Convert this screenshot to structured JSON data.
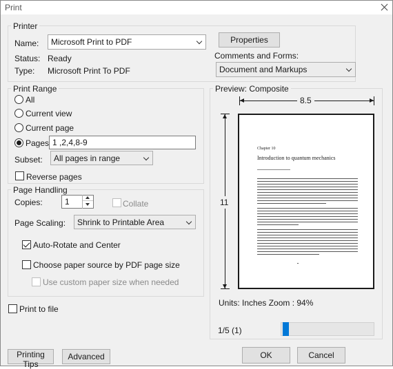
{
  "window": {
    "title": "Print"
  },
  "printer": {
    "group_label": "Printer",
    "name_label": "Name:",
    "name_value": "Microsoft Print to PDF",
    "status_label": "Status:",
    "status_value": "Ready",
    "type_label": "Type:",
    "type_value": "Microsoft Print To PDF",
    "properties_button": "Properties",
    "comments_label": "Comments and Forms:",
    "comments_value": "Document and Markups"
  },
  "print_range": {
    "group_label": "Print Range",
    "all": "All",
    "current_view": "Current view",
    "current_page": "Current page",
    "pages": "Pages",
    "pages_value": "1 ,2,4,8-9",
    "subset_label": "Subset:",
    "subset_value": "All pages in range",
    "reverse_pages": "Reverse pages"
  },
  "page_handling": {
    "group_label": "Page Handling",
    "copies_label": "Copies:",
    "copies_value": "1",
    "collate": "Collate",
    "scaling_label": "Page Scaling:",
    "scaling_value": "Shrink to Printable Area",
    "auto_rotate": "Auto-Rotate and Center",
    "paper_source": "Choose paper source by PDF page size",
    "custom_paper": "Use custom paper size when needed"
  },
  "print_to_file": "Print to file",
  "preview": {
    "header": "Preview: Composite",
    "width_label": "8.5",
    "height_label": "11",
    "page_content": {
      "chapter": "Chapter 10",
      "title": "Introduction to quantum mechanics"
    },
    "units_zoom": "Units: Inches Zoom :  94%",
    "page_indicator": "1/5 (1)",
    "slider_position": 0.02
  },
  "buttons": {
    "printing_tips": "Printing Tips",
    "advanced": "Advanced",
    "ok": "OK",
    "cancel": "Cancel"
  },
  "colors": {
    "dialog_bg": "#f0f0f0",
    "accent": "#0078d7",
    "button_bg": "#e1e1e1"
  }
}
